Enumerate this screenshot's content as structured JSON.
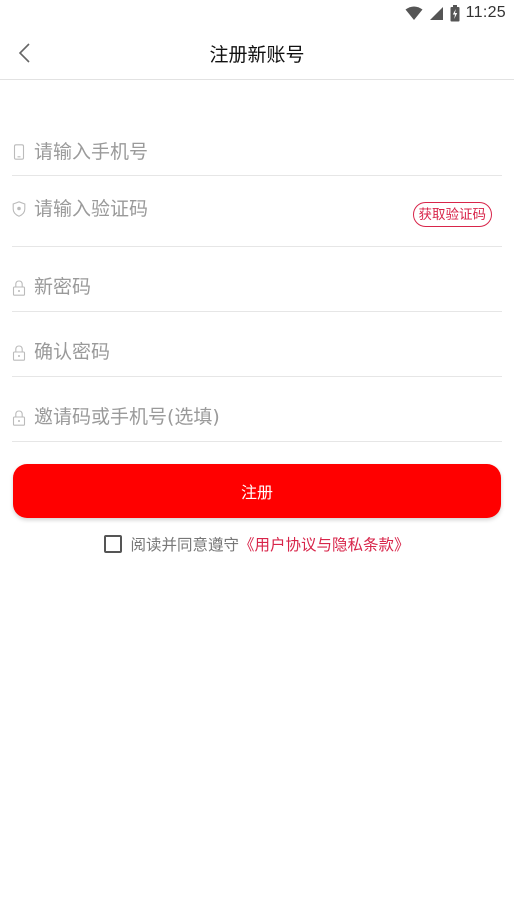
{
  "status_bar": {
    "time": "11:25",
    "icons": [
      "wifi-icon",
      "signal-icon",
      "battery-charging-icon"
    ]
  },
  "nav": {
    "title": "注册新账号",
    "back_icon": "chevron-left-icon"
  },
  "form": {
    "phone": {
      "placeholder": "请输入手机号",
      "value": "",
      "icon": "phone-icon"
    },
    "code": {
      "placeholder": "请输入验证码",
      "value": "",
      "icon": "shield-icon",
      "get_code_label": "获取验证码"
    },
    "new_password": {
      "placeholder": "新密码",
      "value": "",
      "icon": "lock-icon"
    },
    "confirm_password": {
      "placeholder": "确认密码",
      "value": "",
      "icon": "lock-icon"
    },
    "invite": {
      "placeholder": "邀请码或手机号(选填)",
      "value": "",
      "icon": "lock-icon"
    }
  },
  "register_label": "注册",
  "agreement": {
    "checked": false,
    "text": "阅读并同意遵守",
    "link": "《用户协议与隐私条款》"
  },
  "colors": {
    "accent": "#d8254a",
    "button": "#ff0000",
    "placeholder": "#9a9a9a",
    "divider": "#e6e6e6"
  }
}
